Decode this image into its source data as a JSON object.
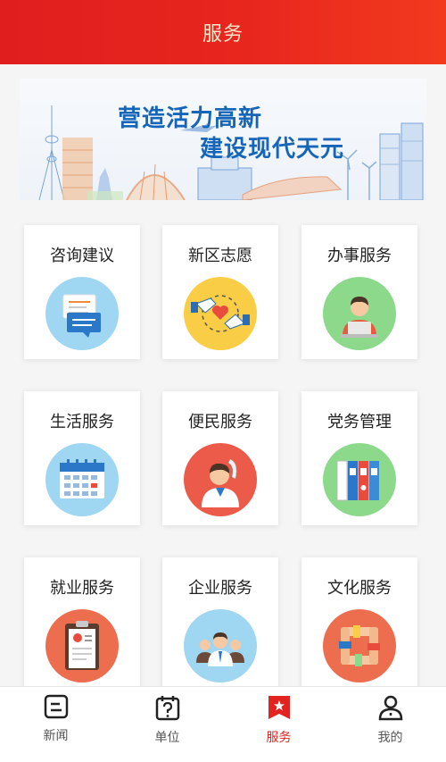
{
  "header": {
    "title": "服务"
  },
  "banner": {
    "line1": "营造活力高新",
    "line2": "建设现代天元"
  },
  "services": [
    {
      "label": "咨询建议",
      "icon": "chat-bubbles-icon",
      "bg": "#9fd6f1"
    },
    {
      "label": "新区志愿",
      "icon": "hands-heart-icon",
      "bg": "#f9cd46"
    },
    {
      "label": "办事服务",
      "icon": "person-laptop-icon",
      "bg": "#8cd98b"
    },
    {
      "label": "生活服务",
      "icon": "calendar-icon",
      "bg": "#9fd6f1"
    },
    {
      "label": "便民服务",
      "icon": "hotline-person-icon",
      "bg": "#ec5a49"
    },
    {
      "label": "党务管理",
      "icon": "binders-icon",
      "bg": "#8cd98b"
    },
    {
      "label": "就业服务",
      "icon": "resume-clipboard-icon",
      "bg": "#ec6e4f"
    },
    {
      "label": "企业服务",
      "icon": "team-people-icon",
      "bg": "#9fd6f1"
    },
    {
      "label": "文化服务",
      "icon": "linked-hands-icon",
      "bg": "#ec6e4f"
    }
  ],
  "tabs": [
    {
      "label": "新闻",
      "icon": "news-icon",
      "active": false
    },
    {
      "label": "单位",
      "icon": "unit-question-icon",
      "active": false
    },
    {
      "label": "服务",
      "icon": "service-flag-icon",
      "active": true
    },
    {
      "label": "我的",
      "icon": "profile-icon",
      "active": false
    }
  ],
  "colors": {
    "brand_red": "#e3231f",
    "banner_blue": "#1565b8",
    "header_text": "#ffe6c8"
  }
}
